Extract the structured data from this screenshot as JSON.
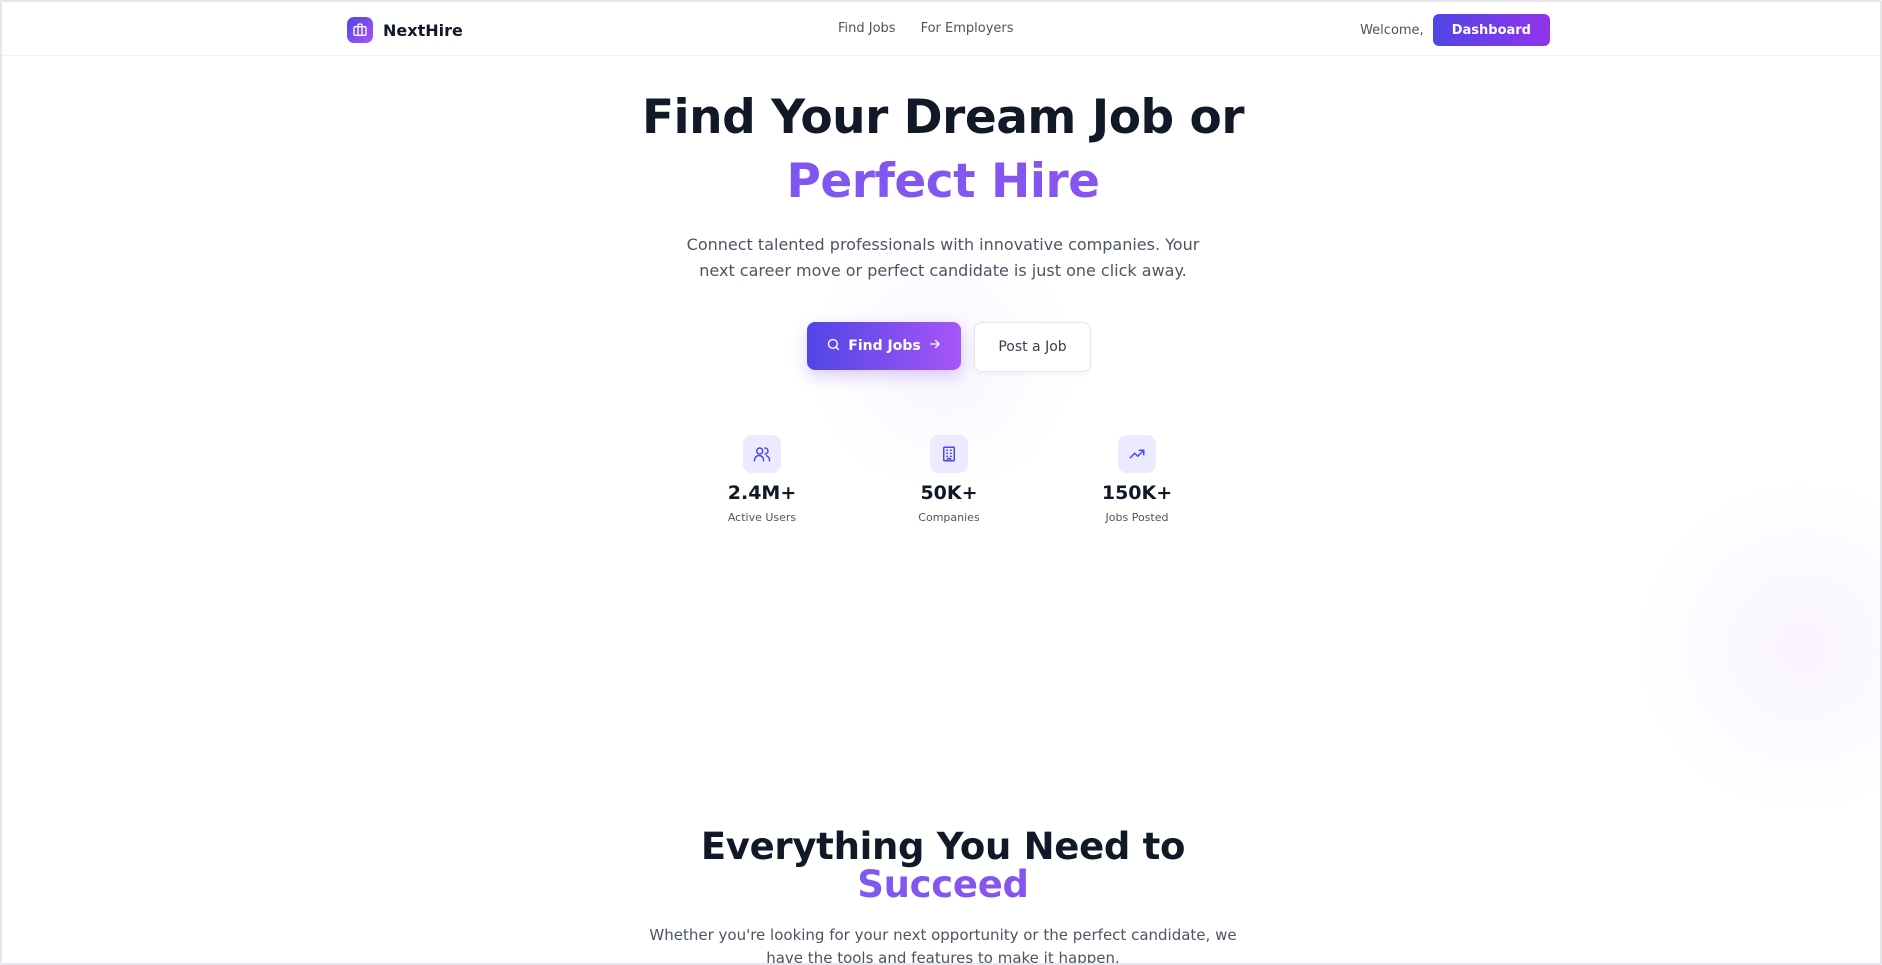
{
  "nav": {
    "brand": "NextHire",
    "links": [
      "Find Jobs",
      "For Employers"
    ],
    "welcome": "Welcome,",
    "dashboard_label": "Dashboard"
  },
  "hero": {
    "title_line1": "Find Your Dream Job or",
    "title_line2": "Perfect Hire",
    "subtitle": "Connect talented professionals with innovative companies. Your next career move or perfect candidate is just one click away.",
    "primary_button": "Find Jobs",
    "secondary_button": "Post a Job"
  },
  "stats": [
    {
      "icon": "users-icon",
      "value": "2.4M+",
      "label": "Active Users"
    },
    {
      "icon": "building-icon",
      "value": "50K+",
      "label": "Companies"
    },
    {
      "icon": "trending-up-icon",
      "value": "150K+",
      "label": "Jobs Posted"
    }
  ],
  "features": {
    "title_line1": "Everything You Need to",
    "title_line2": "Succeed",
    "subtitle": "Whether you're looking for your next opportunity or the perfect candidate, we have the tools and features to make it happen."
  },
  "colors": {
    "accent_start": "#4f46e5",
    "accent_end": "#a855f7",
    "text_dark": "#111827",
    "text_muted": "#4b5563"
  }
}
